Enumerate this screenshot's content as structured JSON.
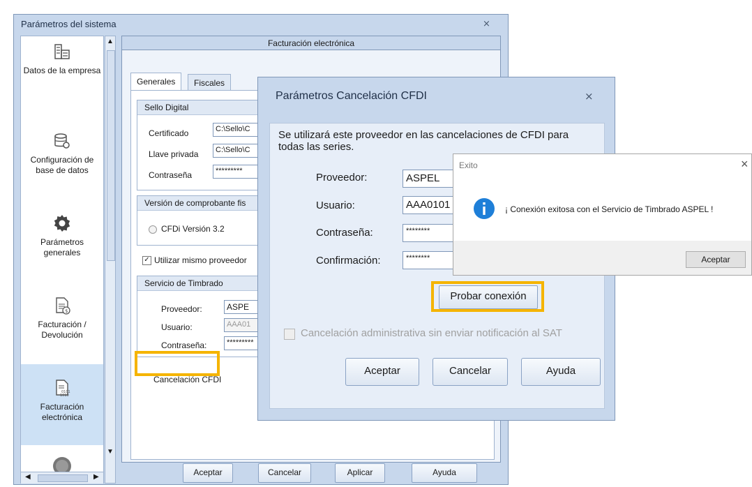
{
  "main": {
    "title": "Parámetros del sistema",
    "close_glyph": "⨯",
    "nav": [
      {
        "label": "Datos de la empresa",
        "icon": "building-icon"
      },
      {
        "label": "Configuración de base de datos",
        "icon": "database-gear-icon"
      },
      {
        "label": "Parámetros generales",
        "icon": "gear-icon"
      },
      {
        "label": "Facturación / Devolución",
        "icon": "invoice-dollar-icon"
      },
      {
        "label": "Facturación electrónica",
        "icon": "invoice-binary-icon"
      }
    ],
    "panel_title": "Facturación electrónica",
    "tabs": [
      "Generales",
      "Fiscales"
    ],
    "sello": {
      "header": "Sello Digital",
      "certificado_label": "Certificado",
      "certificado_value": "C:\\Sello\\C",
      "llave_label": "Llave privada",
      "llave_value": "C:\\Sello\\C",
      "contrasena_label": "Contraseña",
      "contrasena_value": "*********"
    },
    "version": {
      "header": "Versión de comprobante fis",
      "option": "CFDi Versión 3.2"
    },
    "same_provider_label": "Utilizar mismo proveedor",
    "timbrado": {
      "header": "Servicio de Timbrado",
      "proveedor_label": "Proveedor:",
      "proveedor_value": "ASPE",
      "usuario_label": "Usuario:",
      "usuario_value": "AAA01",
      "contrasena_label": "Contraseña:",
      "contrasena_value": "*********"
    },
    "cancel_link": "Cancelación CFDI",
    "buttons": {
      "aceptar": "Aceptar",
      "cancelar": "Cancelar",
      "aplicar": "Aplicar",
      "ayuda": "Ayuda"
    }
  },
  "dialog": {
    "title": "Parámetros Cancelación CFDI",
    "close_glyph": "⨯",
    "description": "Se utilizará este proveedor en las cancelaciones de CFDI para todas las series.",
    "proveedor_label": "Proveedor:",
    "proveedor_value": "ASPEL",
    "usuario_label": "Usuario:",
    "usuario_value": "AAA0101",
    "contrasena_label": "Contraseña:",
    "contrasena_value": "********",
    "confirmacion_label": "Confirmación:",
    "confirmacion_value": "********",
    "probar_label": "Probar conexión",
    "checkbox_label": "Cancelación administrativa sin enviar notificación al SAT",
    "buttons": {
      "aceptar": "Aceptar",
      "cancelar": "Cancelar",
      "ayuda": "Ayuda"
    }
  },
  "popup": {
    "title": "Exito",
    "close_glyph": "×",
    "message": "¡ Conexión exitosa con el Servicio de Timbrado ASPEL !",
    "button": "Aceptar",
    "icon": "info-icon"
  },
  "colors": {
    "highlight": "#f5b400",
    "info": "#1e7fd8"
  }
}
